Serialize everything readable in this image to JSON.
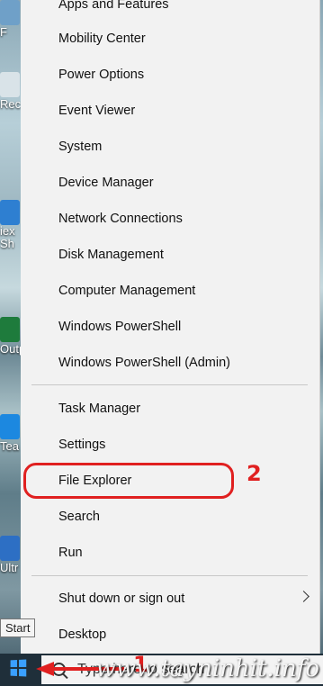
{
  "desktop": {
    "icons": [
      {
        "label": "F"
      },
      {
        "label": "Rec"
      },
      {
        "label": "iex Sh"
      },
      {
        "label": "Outp"
      },
      {
        "label": "Tea"
      },
      {
        "label": "Ultr"
      }
    ]
  },
  "menu": {
    "items": [
      {
        "label": "Apps and Features"
      },
      {
        "label": "Mobility Center"
      },
      {
        "label": "Power Options"
      },
      {
        "label": "Event Viewer"
      },
      {
        "label": "System"
      },
      {
        "label": "Device Manager"
      },
      {
        "label": "Network Connections"
      },
      {
        "label": "Disk Management"
      },
      {
        "label": "Computer Management"
      },
      {
        "label": "Windows PowerShell"
      },
      {
        "label": "Windows PowerShell (Admin)"
      },
      {
        "label": "Task Manager"
      },
      {
        "label": "Settings"
      },
      {
        "label": "File Explorer"
      },
      {
        "label": "Search"
      },
      {
        "label": "Run"
      },
      {
        "label": "Shut down or sign out"
      },
      {
        "label": "Desktop"
      }
    ]
  },
  "annotations": {
    "step1": "1",
    "step2": "2",
    "accent_color": "#e02020"
  },
  "taskbar": {
    "start_tooltip": "Start",
    "search_placeholder": "Type here to search"
  },
  "watermark": "www.tayninhit.info"
}
